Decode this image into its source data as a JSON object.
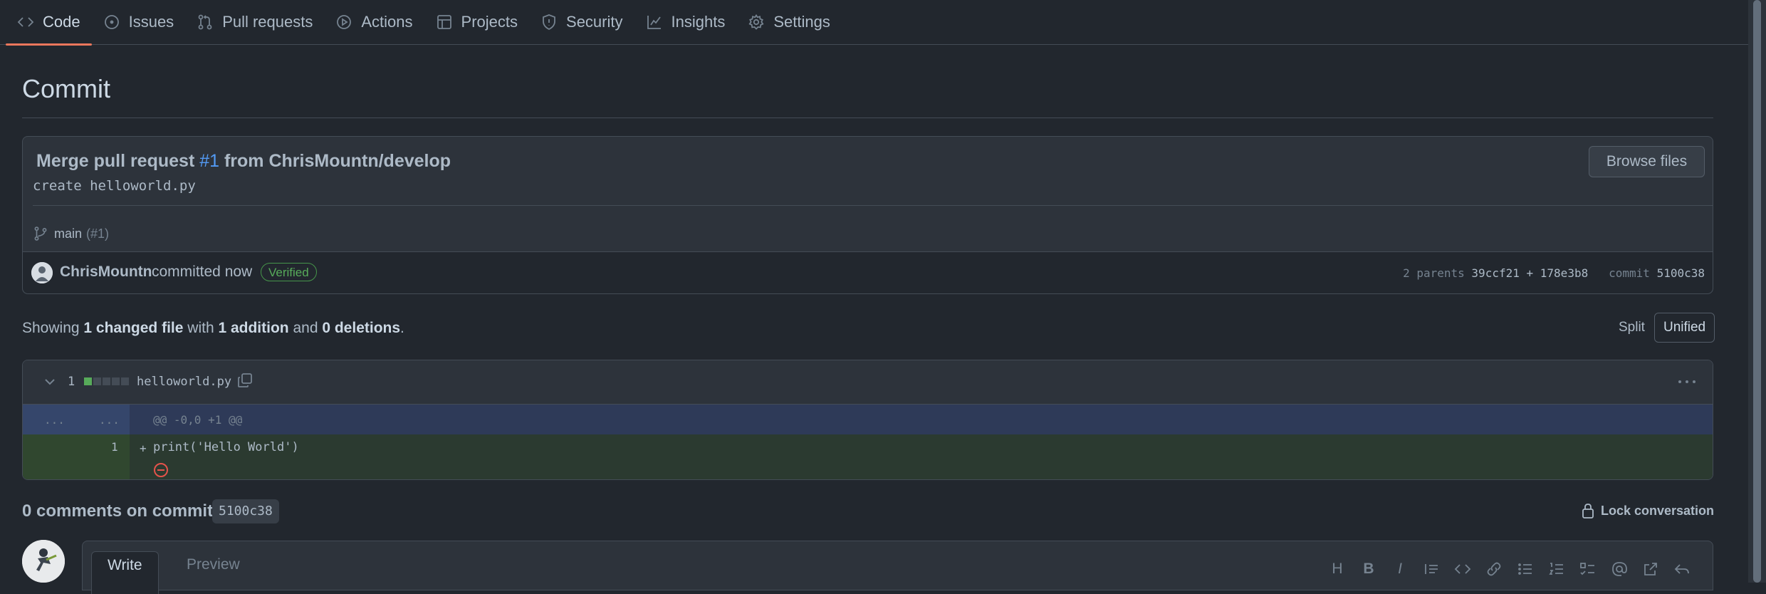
{
  "nav": {
    "tabs": [
      {
        "label": "Code",
        "icon": "code-icon"
      },
      {
        "label": "Issues",
        "icon": "issue-opened-icon"
      },
      {
        "label": "Pull requests",
        "icon": "git-pull-request-icon"
      },
      {
        "label": "Actions",
        "icon": "play-icon"
      },
      {
        "label": "Projects",
        "icon": "table-icon"
      },
      {
        "label": "Security",
        "icon": "shield-icon"
      },
      {
        "label": "Insights",
        "icon": "graph-icon"
      },
      {
        "label": "Settings",
        "icon": "gear-icon"
      }
    ]
  },
  "page": {
    "title": "Commit"
  },
  "commit": {
    "title_prefix": "Merge pull request ",
    "pr_ref": "#1",
    "title_suffix": " from ChrisMountn/develop",
    "description": "create helloworld.py",
    "browse_label": "Browse files",
    "branch": "main",
    "branch_pr": "(#1)",
    "author": "ChrisMountn",
    "action": "committed now",
    "verified": "Verified",
    "parents_label": "2 parents",
    "parent1": "39ccf21",
    "plus": "+",
    "parent2": "178e3b8",
    "commit_label": "commit",
    "sha": "5100c38"
  },
  "summary": {
    "showing": "Showing ",
    "changed": "1 changed file",
    "with": " with ",
    "additions": "1 addition",
    "and": " and ",
    "deletions": "0 deletions",
    "end": ".",
    "split_label": "Split",
    "unified_label": "Unified"
  },
  "diff": {
    "count": "1",
    "file": "helloworld.py",
    "hunk_dots_left": "...",
    "hunk_dots_right": "...",
    "hunk_header": "@@ -0,0 +1 @@",
    "line_number": "1",
    "plus": "+",
    "code": "print('Hello World')"
  },
  "comments": {
    "title": "0 comments on commit",
    "sha": "5100c38",
    "lock_label": "Lock conversation",
    "write_tab": "Write",
    "preview_tab": "Preview",
    "toolbar_heading": "H",
    "toolbar_bold": "B",
    "toolbar_italic": "I"
  },
  "colors": {
    "accent": "#ec775c",
    "link": "#539bf5",
    "success": "#57ab5a",
    "danger": "#e5534b"
  }
}
